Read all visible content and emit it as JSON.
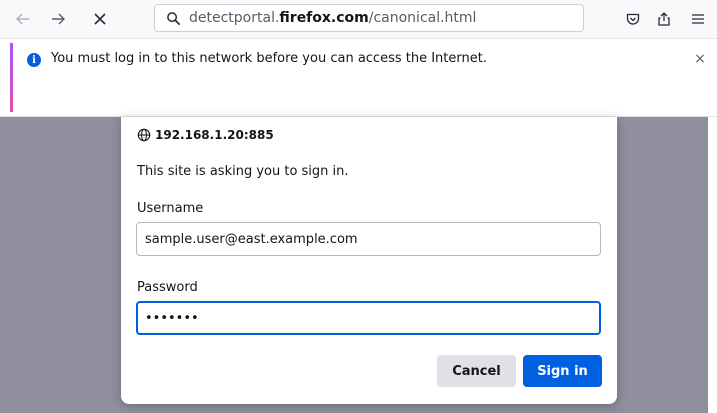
{
  "toolbar": {
    "url_prefix": "detectportal.",
    "url_domain": "firefox.com",
    "url_suffix": "/canonical.html",
    "icons": [
      "back-icon",
      "forward-icon",
      "stop-icon",
      "search-icon",
      "pocket-icon",
      "share-icon",
      "menu-icon"
    ]
  },
  "notification": {
    "message": "You must log in to this network before you can access the Internet.",
    "info_glyph": "i",
    "close_glyph": "×"
  },
  "dialog": {
    "origin": "192.168.1.20:885",
    "message": "This site is asking you to sign in.",
    "username_label": "Username",
    "username_value": "sample.user@east.example.com",
    "password_label": "Password",
    "password_value": "•••••••",
    "cancel_label": "Cancel",
    "signin_label": "Sign in"
  },
  "colors": {
    "accent": "#0061e0",
    "page_overlay": "#8f8f9d"
  }
}
